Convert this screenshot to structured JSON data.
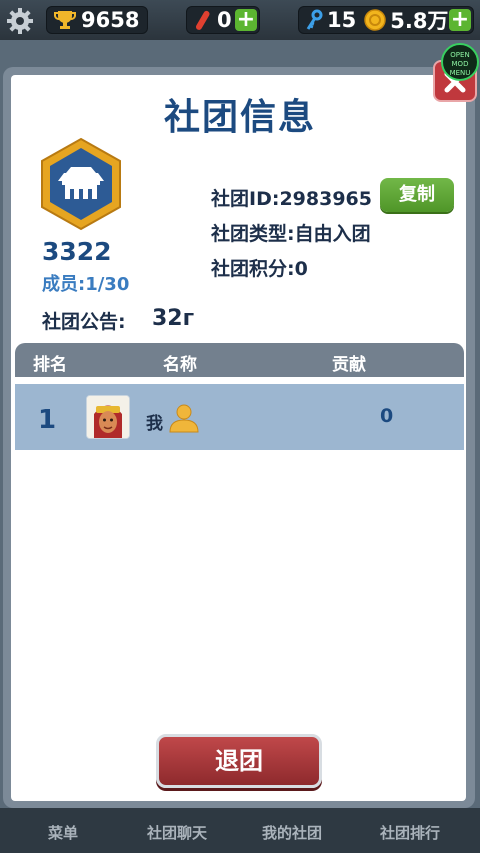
{
  "topbar": {
    "trophies": "9658",
    "boards": "0",
    "keys": "15",
    "coins": "5.8万"
  },
  "dialog": {
    "title": "社团信息",
    "club_number": "3322",
    "members": "成员:1/30",
    "club_id": "社团ID:2983965",
    "club_type": "社团类型:自由入团",
    "club_points": "社团积分:0",
    "copy_label": "复制",
    "notice_label": "社团公告:",
    "notice_value": "32г"
  },
  "table": {
    "headers": [
      "排名",
      "名称",
      "贡献"
    ],
    "rows": [
      {
        "rank": "1",
        "name": "我",
        "contribution": "0"
      }
    ]
  },
  "leave_label": "退团",
  "mod_menu": {
    "line1": "OPEN",
    "line2": "MOD MENU"
  },
  "bottom_nav": [
    "菜单",
    "社团聊天",
    "我的社团",
    "社团排行"
  ],
  "colors": {
    "title_blue": "#1c4a80",
    "copy_green": "#5ba535",
    "leave_red": "#a83a3d",
    "row_blue": "#9cb6d0",
    "header_gray": "#73808e"
  },
  "icons": [
    "gear-icon",
    "trophy-icon",
    "hoverboard-icon",
    "key-icon",
    "coin-icon",
    "plus-icon",
    "club-badge-icon",
    "avatar-icon",
    "person-icon",
    "close-icon"
  ]
}
